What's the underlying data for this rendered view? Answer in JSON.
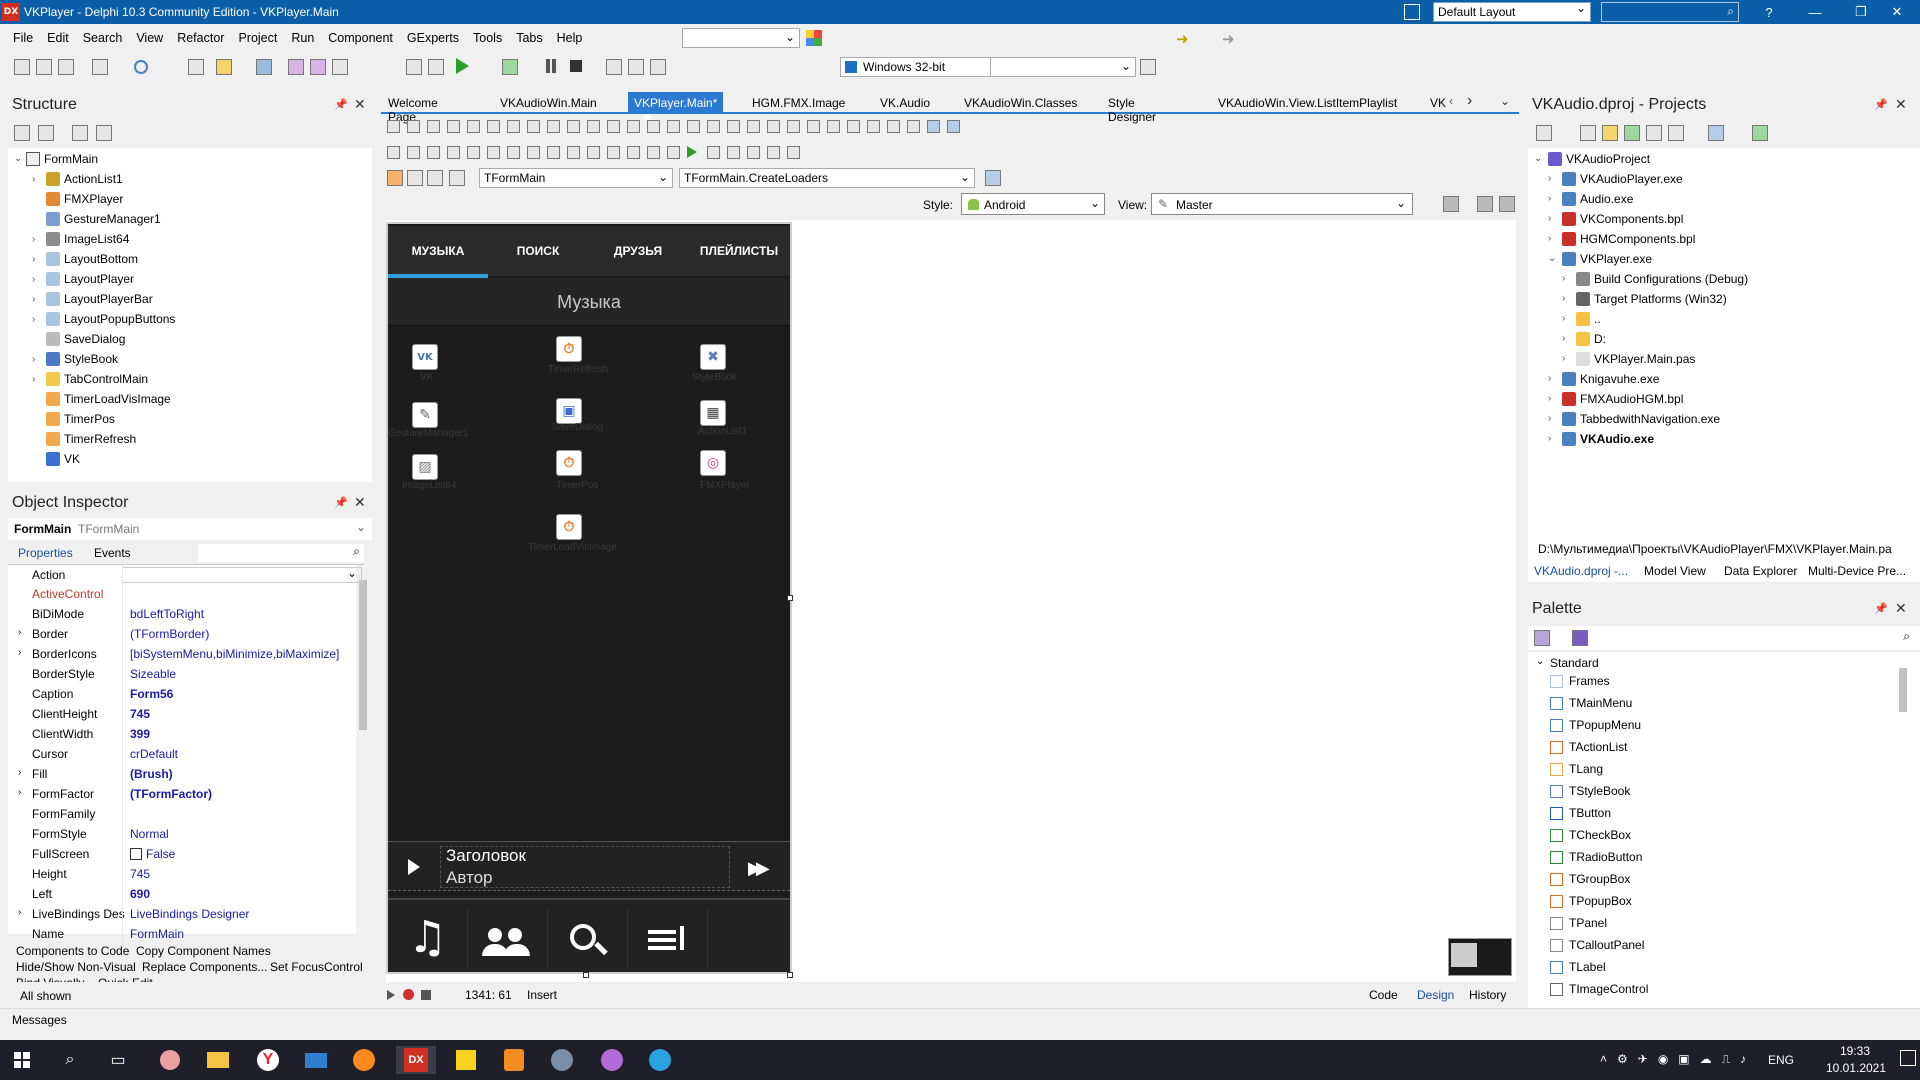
{
  "window": {
    "title": "VKPlayer - Delphi 10.3 Community Edition - VKPlayer.Main",
    "logo": "DX",
    "layout": "Default Layout",
    "help": "?"
  },
  "menu": [
    "File",
    "Edit",
    "Search",
    "View",
    "Refactor",
    "Project",
    "Run",
    "Component",
    "GExperts",
    "Tools",
    "Tabs",
    "Help"
  ],
  "toolbar": {
    "platform": "Windows 32-bit"
  },
  "structure": {
    "title": "Structure",
    "root": "FormMain",
    "items": [
      "ActionList1",
      "FMXPlayer",
      "GestureManager1",
      "ImageList64",
      "LayoutBottom",
      "LayoutPlayer",
      "LayoutPlayerBar",
      "LayoutPopupButtons",
      "SaveDialog",
      "StyleBook",
      "TabControlMain",
      "TimerLoadVisImage",
      "TimerPos",
      "TimerRefresh",
      "VK"
    ]
  },
  "object_inspector": {
    "title": "Object Inspector",
    "selected": "FormMain",
    "selected_type": "TFormMain",
    "tabs": [
      "Properties",
      "Events"
    ],
    "rows": [
      {
        "k": "Action",
        "v": ""
      },
      {
        "k": "ActiveControl",
        "v": ""
      },
      {
        "k": "BiDiMode",
        "v": "bdLeftToRight"
      },
      {
        "k": "Border",
        "v": "(TFormBorder)"
      },
      {
        "k": "BorderIcons",
        "v": "[biSystemMenu,biMinimize,biMaximize]"
      },
      {
        "k": "BorderStyle",
        "v": "Sizeable"
      },
      {
        "k": "Caption",
        "v": "Form56"
      },
      {
        "k": "ClientHeight",
        "v": "745"
      },
      {
        "k": "ClientWidth",
        "v": "399"
      },
      {
        "k": "Cursor",
        "v": "crDefault"
      },
      {
        "k": "Fill",
        "v": "(Brush)"
      },
      {
        "k": "FormFactor",
        "v": "(TFormFactor)"
      },
      {
        "k": "FormFamily",
        "v": ""
      },
      {
        "k": "FormStyle",
        "v": "Normal"
      },
      {
        "k": "FullScreen",
        "v": "False"
      },
      {
        "k": "Height",
        "v": "745"
      },
      {
        "k": "Left",
        "v": "690"
      },
      {
        "k": "LiveBindings Des",
        "v": "LiveBindings Designer"
      },
      {
        "k": "Name",
        "v": "FormMain"
      }
    ],
    "actions": [
      "Components to Code",
      "Copy Component Names",
      "Hide/Show Non-Visual",
      "Replace Components...",
      "Set FocusControl",
      "Bind Visually...",
      "Quick Edit..."
    ],
    "status": "All shown"
  },
  "messages": "Messages",
  "editor": {
    "tabs": [
      "Welcome Page",
      "VKAudioWin.Main",
      "VKPlayer.Main*",
      "HGM.FMX.Image",
      "VK.Audio",
      "VKAudioWin.Classes",
      "Style Designer",
      "VKAudioWin.View.ListItemPlaylist",
      "VK"
    ],
    "active_tab": 2,
    "class_combo": "TFormMain",
    "method_combo": "TFormMain.CreateLoaders",
    "style_label": "Style:",
    "style_value": "Android",
    "view_label": "View:",
    "view_value": "Master",
    "status_pos": "1341:  61",
    "status_mode": "Insert",
    "bottom_tabs": [
      "Code",
      "Design",
      "History"
    ],
    "active_bottom_tab": "Design"
  },
  "form": {
    "tabs": [
      "МУЗЫКА",
      "ПОИСК",
      "ДРУЗЬЯ",
      "ПЛЕЙЛИСТЫ"
    ],
    "header": "Музыка",
    "components": [
      {
        "name": "VK"
      },
      {
        "name": "TimerRefresh"
      },
      {
        "name": "StyleBook"
      },
      {
        "name": "GestureManager1"
      },
      {
        "name": "SaveDialog"
      },
      {
        "name": "ActionList1"
      },
      {
        "name": "ImageList64"
      },
      {
        "name": "TimerPos"
      },
      {
        "name": "FMXPlayer"
      },
      {
        "name": "TimerLoadVisImage"
      }
    ],
    "player_title": "Заголовок",
    "player_artist": "Автор"
  },
  "projects": {
    "title": "VKAudio.dproj - Projects",
    "items": [
      {
        "label": "VKAudioProject",
        "bold": false
      },
      {
        "label": "VKAudioPlayer.exe",
        "bold": false
      },
      {
        "label": "Audio.exe",
        "bold": false
      },
      {
        "label": "VKComponents.bpl",
        "bold": false
      },
      {
        "label": "HGMComponents.bpl",
        "bold": false
      },
      {
        "label": "VKPlayer.exe",
        "bold": false
      },
      {
        "label": "Build Configurations (Debug)",
        "bold": false
      },
      {
        "label": "Target Platforms (Win32)",
        "bold": false
      },
      {
        "label": "..",
        "bold": false
      },
      {
        "label": "D:",
        "bold": false
      },
      {
        "label": "VKPlayer.Main.pas",
        "bold": false
      },
      {
        "label": "Knigavuhe.exe",
        "bold": false
      },
      {
        "label": "FMXAudioHGM.bpl",
        "bold": false
      },
      {
        "label": "TabbedwithNavigation.exe",
        "bold": false
      },
      {
        "label": "VKAudio.exe",
        "bold": true
      }
    ],
    "path": "D:\\Мультимедиа\\Проекты\\VKAudioPlayer\\FMX\\VKPlayer.Main.pa",
    "tabs": [
      "VKAudio.dproj -...",
      "Model View",
      "Data Explorer",
      "Multi-Device Pre..."
    ]
  },
  "palette": {
    "title": "Palette",
    "category": "Standard",
    "items": [
      "Frames",
      "TMainMenu",
      "TPopupMenu",
      "TActionList",
      "TLang",
      "TStyleBook",
      "TButton",
      "TCheckBox",
      "TRadioButton",
      "TGroupBox",
      "TPopupBox",
      "TPanel",
      "TCalloutPanel",
      "TLabel",
      "TImageControl"
    ]
  },
  "taskbar": {
    "tray": "ENG",
    "time": "19:33",
    "date": "10.01.2021",
    "dx": "DX"
  },
  "colors": {
    "accent": "#0b5ea8",
    "form_bg": "#1c1c1c",
    "tab_underline": "#2d9fd9",
    "link_blue": "#1a1aa6",
    "red_prop": "#c0392b"
  }
}
